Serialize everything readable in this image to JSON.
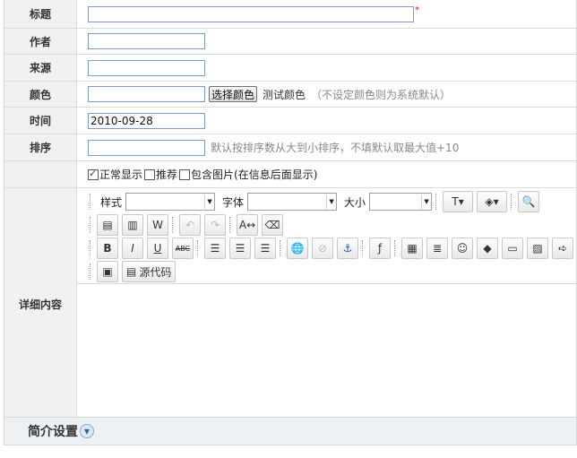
{
  "fields": {
    "title": {
      "label": "标题",
      "value": "",
      "required_mark": "*"
    },
    "author": {
      "label": "作者",
      "value": ""
    },
    "source": {
      "label": "来源",
      "value": ""
    },
    "color": {
      "label": "颜色",
      "value": "",
      "pick_button": "选择颜色",
      "test_text": "测试颜色",
      "hint": "（不设定颜色则为系统默认）"
    },
    "time": {
      "label": "时间",
      "value": "2010-09-28"
    },
    "sort": {
      "label": "排序",
      "value": "",
      "hint": "默认按排序数从大到小排序，不填默认取最大值+10"
    }
  },
  "options": [
    {
      "label": "正常显示",
      "checked": true
    },
    {
      "label": "推荐",
      "checked": false
    },
    {
      "label": "包含图片(在信息后面显示)",
      "checked": false
    }
  ],
  "content": {
    "label": "详细内容",
    "style_label": "样式",
    "font_label": "字体",
    "size_label": "大小",
    "source_code_label": "源代码"
  },
  "intro": {
    "label": "简介设置"
  }
}
